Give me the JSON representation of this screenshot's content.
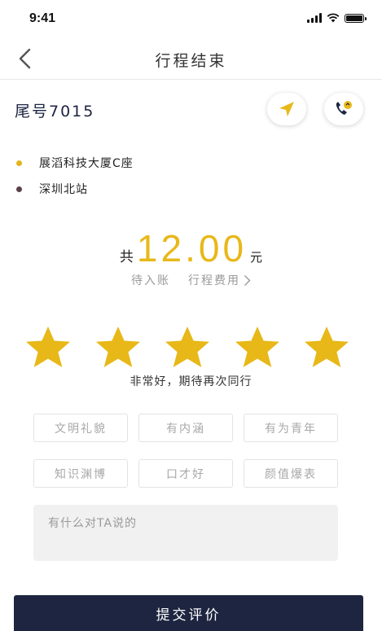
{
  "status_bar": {
    "time": "9:41"
  },
  "nav": {
    "title": "行程结束"
  },
  "driver": {
    "plate": "尾号7015"
  },
  "route": {
    "start": {
      "name": "展滔科技大厦C座",
      "color": "#e3b41c"
    },
    "end": {
      "name": "深圳北站",
      "color": "#5a4048"
    }
  },
  "fare": {
    "prefix": "共",
    "amount": "12.00",
    "unit": "元",
    "status": "待入账",
    "detail_link": "行程费用"
  },
  "rating": {
    "stars_filled": 5,
    "stars_total": 5,
    "text": "非常好，期待再次同行"
  },
  "tags": [
    "文明礼貌",
    "有内涵",
    "有为青年",
    "知识渊博",
    "口才好",
    "颜值爆表"
  ],
  "comment": {
    "placeholder": "有什么对TA说的",
    "value": ""
  },
  "submit": {
    "label": "提交评价"
  },
  "colors": {
    "accent": "#e8b81a",
    "primary": "#1d2540",
    "star": "#e7b818"
  }
}
